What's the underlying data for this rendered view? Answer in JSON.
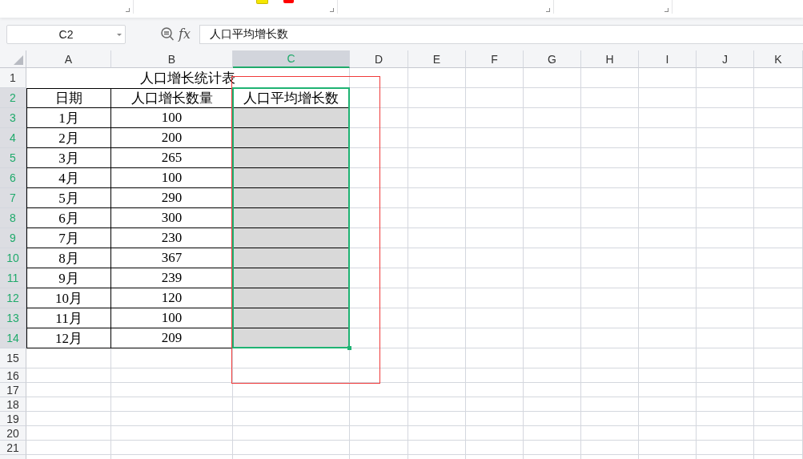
{
  "formula_bar": {
    "cell_ref": "C2",
    "fx": "fx",
    "value": "人口平均增长数"
  },
  "columns": [
    {
      "label": "A",
      "selected": false
    },
    {
      "label": "B",
      "selected": false
    },
    {
      "label": "C",
      "selected": true
    },
    {
      "label": "D",
      "selected": false
    },
    {
      "label": "E",
      "selected": false
    },
    {
      "label": "F",
      "selected": false
    },
    {
      "label": "G",
      "selected": false
    },
    {
      "label": "H",
      "selected": false
    },
    {
      "label": "I",
      "selected": false
    },
    {
      "label": "J",
      "selected": false
    },
    {
      "label": "K",
      "selected": false
    }
  ],
  "rows": [
    {
      "number": "1",
      "selected": false
    },
    {
      "number": "2",
      "selected": true
    },
    {
      "number": "3",
      "selected": true
    },
    {
      "number": "4",
      "selected": true
    },
    {
      "number": "5",
      "selected": true
    },
    {
      "number": "6",
      "selected": true
    },
    {
      "number": "7",
      "selected": true
    },
    {
      "number": "8",
      "selected": true
    },
    {
      "number": "9",
      "selected": true
    },
    {
      "number": "10",
      "selected": true
    },
    {
      "number": "11",
      "selected": true
    },
    {
      "number": "12",
      "selected": true
    },
    {
      "number": "13",
      "selected": true
    },
    {
      "number": "14",
      "selected": true
    },
    {
      "number": "15",
      "selected": false
    },
    {
      "number": "16",
      "selected": false
    },
    {
      "number": "17",
      "selected": false
    },
    {
      "number": "18",
      "selected": false
    },
    {
      "number": "19",
      "selected": false
    },
    {
      "number": "20",
      "selected": false
    },
    {
      "number": "21",
      "selected": false
    }
  ],
  "sheet": {
    "title": "人口增长统计表",
    "header": [
      "日期",
      "人口增长数量",
      "人口平均增长数"
    ],
    "data": [
      {
        "month": "1月",
        "count": "100"
      },
      {
        "month": "2月",
        "count": "200"
      },
      {
        "month": "3月",
        "count": "265"
      },
      {
        "month": "4月",
        "count": "100"
      },
      {
        "month": "5月",
        "count": "290"
      },
      {
        "month": "6月",
        "count": "300"
      },
      {
        "month": "7月",
        "count": "230"
      },
      {
        "month": "8月",
        "count": "367"
      },
      {
        "month": "9月",
        "count": "239"
      },
      {
        "month": "10月",
        "count": "120"
      },
      {
        "month": "11月",
        "count": "100"
      },
      {
        "month": "12月",
        "count": "209"
      }
    ]
  }
}
